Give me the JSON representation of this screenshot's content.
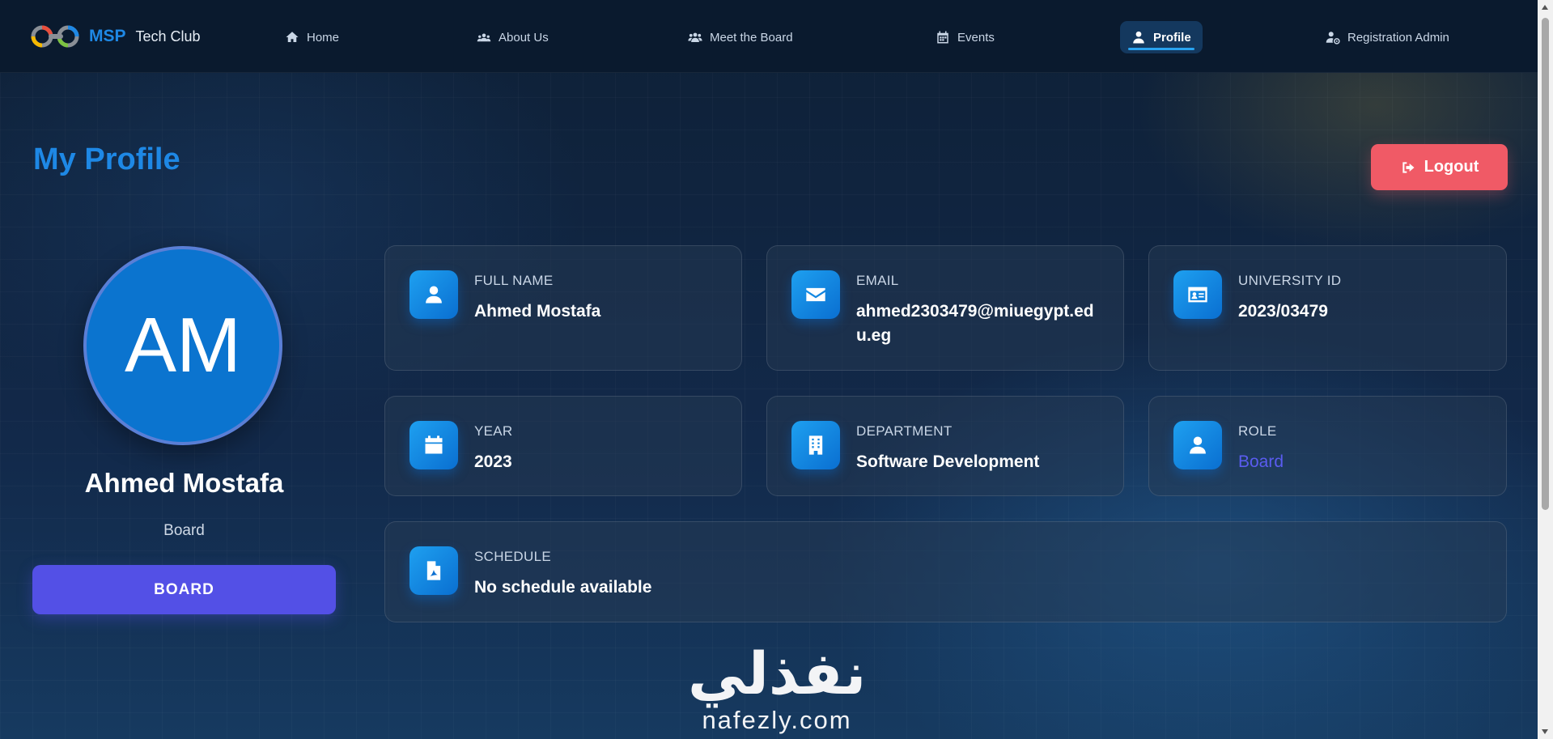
{
  "brand": {
    "msp": "MSP",
    "club": "Tech Club"
  },
  "nav": [
    {
      "label": "Home",
      "icon": "home-icon"
    },
    {
      "label": "About Us",
      "icon": "users-icon"
    },
    {
      "label": "Meet the Board",
      "icon": "group-icon"
    },
    {
      "label": "Events",
      "icon": "calendar-icon"
    },
    {
      "label": "Profile",
      "icon": "user-icon",
      "active": true
    },
    {
      "label": "Registration Admin",
      "icon": "user-cog-icon"
    }
  ],
  "page": {
    "title": "My Profile",
    "logout_label": "Logout"
  },
  "profile": {
    "initials": "AM",
    "name": "Ahmed Mostafa",
    "role": "Board",
    "role_button": "BOARD"
  },
  "cards": {
    "full_name": {
      "label": "FULL NAME",
      "value": "Ahmed Mostafa",
      "icon": "user-icon"
    },
    "email": {
      "label": "EMAIL",
      "value": "ahmed2303479@miuegypt.edu.eg",
      "icon": "envelope-icon"
    },
    "university_id": {
      "label": "UNIVERSITY ID",
      "value": "2023/03479",
      "icon": "id-card-icon"
    },
    "year": {
      "label": "YEAR",
      "value": "2023",
      "icon": "calendar-icon"
    },
    "department": {
      "label": "DEPARTMENT",
      "value": "Software Development",
      "icon": "building-icon"
    },
    "role": {
      "label": "ROLE",
      "value": "Board",
      "icon": "user-icon"
    },
    "schedule": {
      "label": "SCHEDULE",
      "value": "No schedule available",
      "icon": "pdf-file-icon"
    }
  },
  "watermark": {
    "arabic": "نفذلي",
    "latin": "nafezly.com"
  },
  "colors": {
    "accent": "#1e88e5",
    "logout": "#f05a66",
    "role_button": "#5350e6",
    "role_text": "#5a5cf0",
    "background": "#12294a"
  }
}
